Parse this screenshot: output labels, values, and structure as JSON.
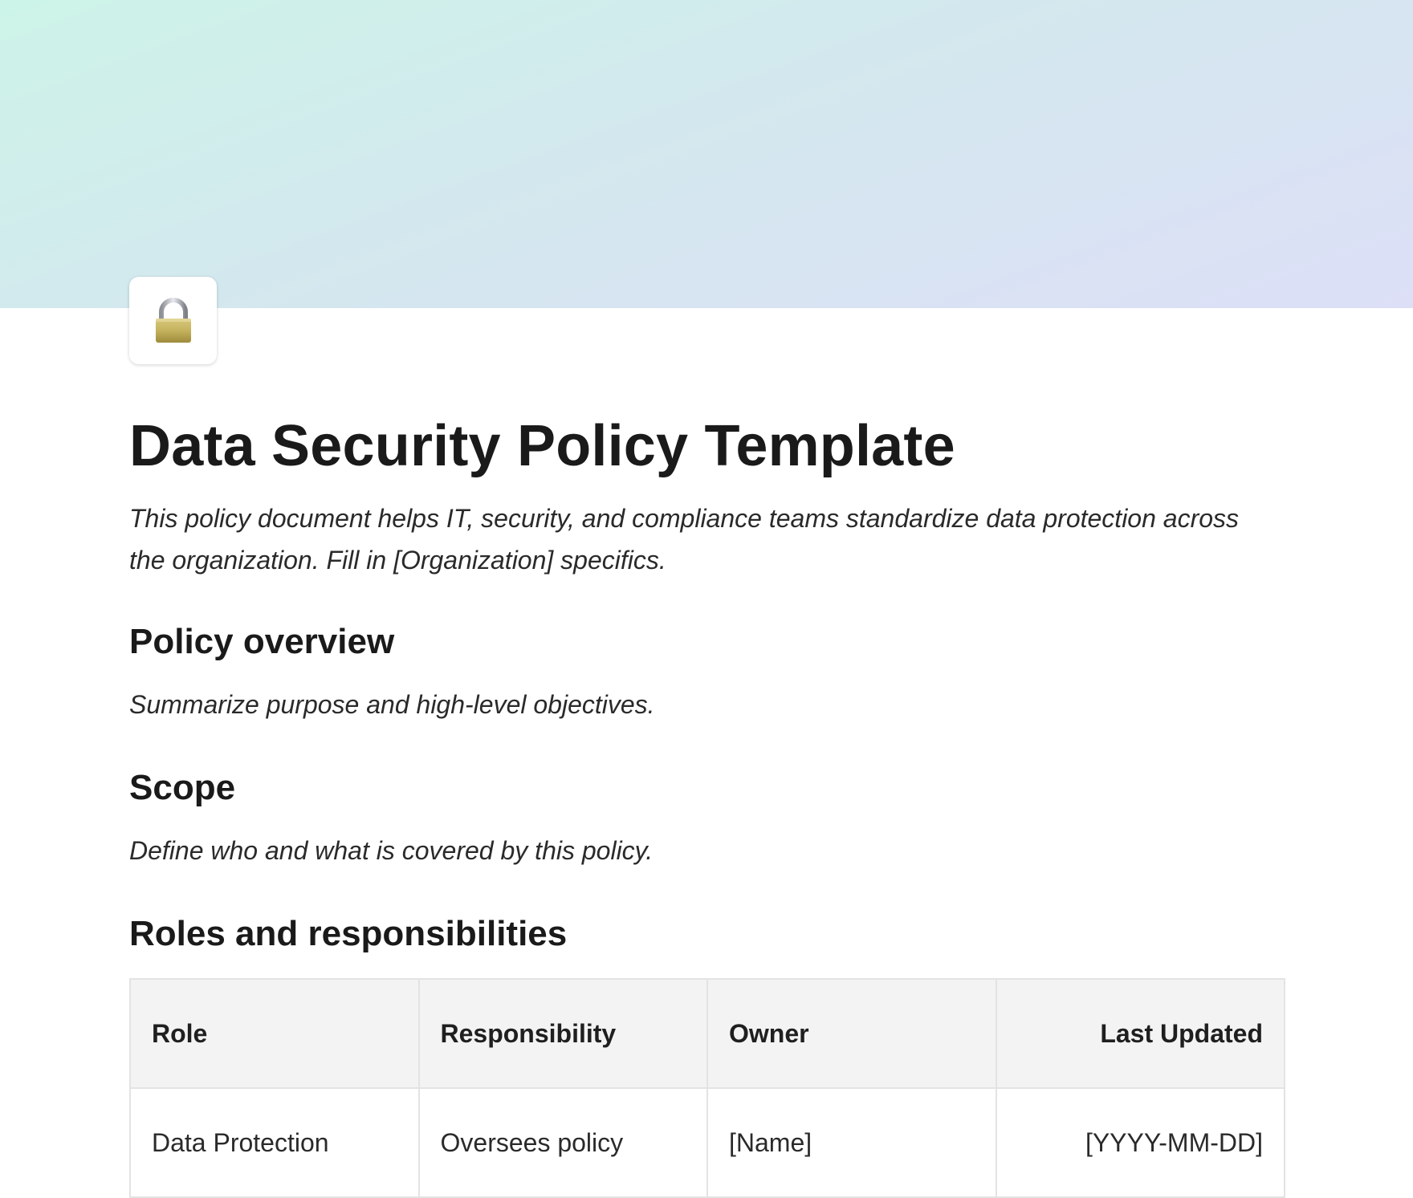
{
  "page": {
    "icon": "lock-icon",
    "title": "Data Security Policy Template",
    "lead": "This policy document helps IT, security, and compliance teams standardize data protection across the organization. Fill in [Organization] specifics."
  },
  "sections": {
    "overview": {
      "heading": "Policy overview",
      "text": "Summarize purpose and high-level objectives."
    },
    "scope": {
      "heading": "Scope",
      "text": "Define who and what is covered by this policy."
    },
    "roles": {
      "heading": "Roles and responsibilities"
    }
  },
  "roles_table": {
    "headers": [
      "Role",
      "Responsibility",
      "Owner",
      "Last Updated"
    ],
    "rows": [
      [
        "Data Protection",
        "Oversees policy",
        "[Name]",
        "[YYYY-MM-DD]"
      ]
    ]
  },
  "colors": {
    "cover_gradient_start": "#cdf4e8",
    "cover_gradient_end": "#dddff7",
    "table_header_bg": "#f3f3f3"
  }
}
